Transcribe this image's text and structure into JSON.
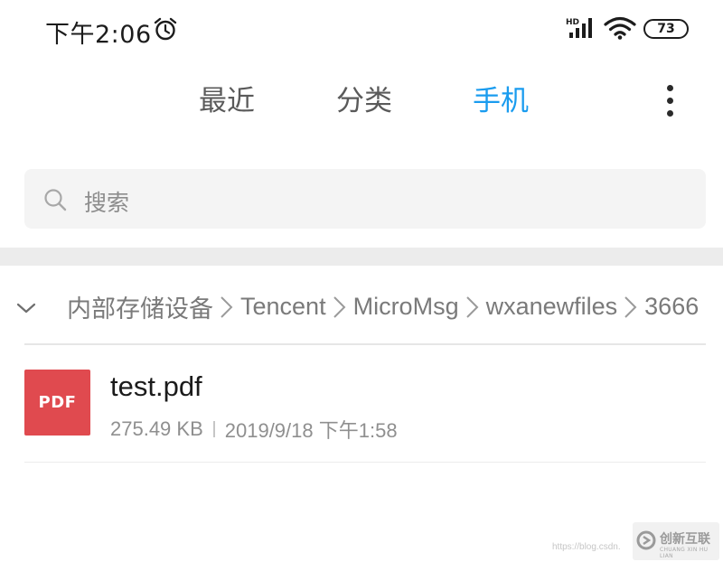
{
  "status_bar": {
    "time": "下午2:06",
    "battery_level": "73",
    "network_label": "HD",
    "icons": [
      "alarm-icon",
      "hd-signal-icon",
      "wifi-icon",
      "battery-icon"
    ]
  },
  "tabs": [
    {
      "label": "最近",
      "active": false
    },
    {
      "label": "分类",
      "active": false
    },
    {
      "label": "手机",
      "active": true
    }
  ],
  "menu": {
    "icon": "more-vertical-icon"
  },
  "search": {
    "placeholder": "搜索",
    "icon": "search-icon"
  },
  "breadcrumb": {
    "icon": "chevron-down-icon",
    "items": [
      "内部存储设备",
      "Tencent",
      "MicroMsg",
      "wxanewfiles",
      "3666"
    ]
  },
  "files": [
    {
      "thumb_label": "PDF",
      "name": "test.pdf",
      "size": "275.49 KB",
      "modified": "2019/9/18 下午1:58"
    }
  ],
  "watermark": {
    "url": "https://blog.csdn.",
    "brand": "创新互联",
    "brand_en": "CHUANG XIN HU LIAN"
  },
  "colors": {
    "accent": "#1a9cef",
    "pdf_red": "#e04a4f",
    "text_primary": "#1b1b1b",
    "text_secondary": "#8f8f8f",
    "search_bg": "#f4f4f4"
  }
}
